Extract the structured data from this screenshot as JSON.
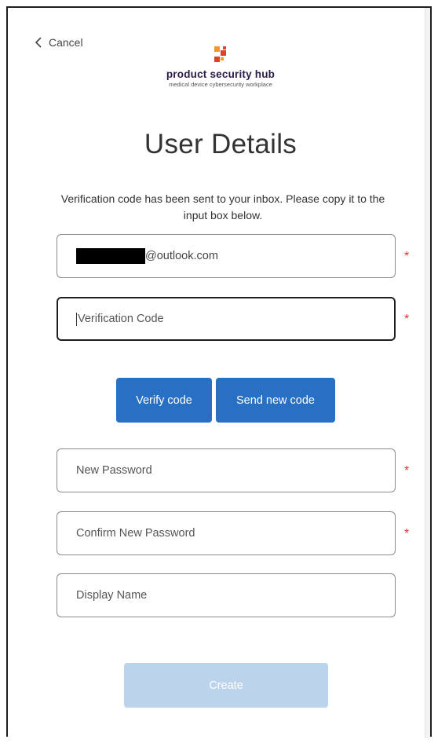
{
  "header": {
    "cancel_label": "Cancel",
    "brand_name": "product security hub",
    "brand_tagline": "medical device cybersecurity workplace"
  },
  "page": {
    "title": "User Details",
    "intro": "Verification code has been sent to your inbox. Please copy it to the input box below."
  },
  "form": {
    "email": {
      "value_suffix": "@outlook.com",
      "required": true
    },
    "verification_code": {
      "placeholder": "Verification Code",
      "required": true
    },
    "verify_button": "Verify code",
    "send_new_code_button": "Send new code",
    "new_password": {
      "placeholder": "New Password",
      "required": true
    },
    "confirm_password": {
      "placeholder": "Confirm New Password",
      "required": true
    },
    "display_name": {
      "placeholder": "Display Name",
      "required": false
    },
    "create_button": "Create",
    "required_marker": "*"
  },
  "colors": {
    "primary": "#2870c4",
    "disabled": "#bcd3ec",
    "required": "#e0312b",
    "logo_red": "#e2402b",
    "logo_orange": "#f29a23"
  }
}
